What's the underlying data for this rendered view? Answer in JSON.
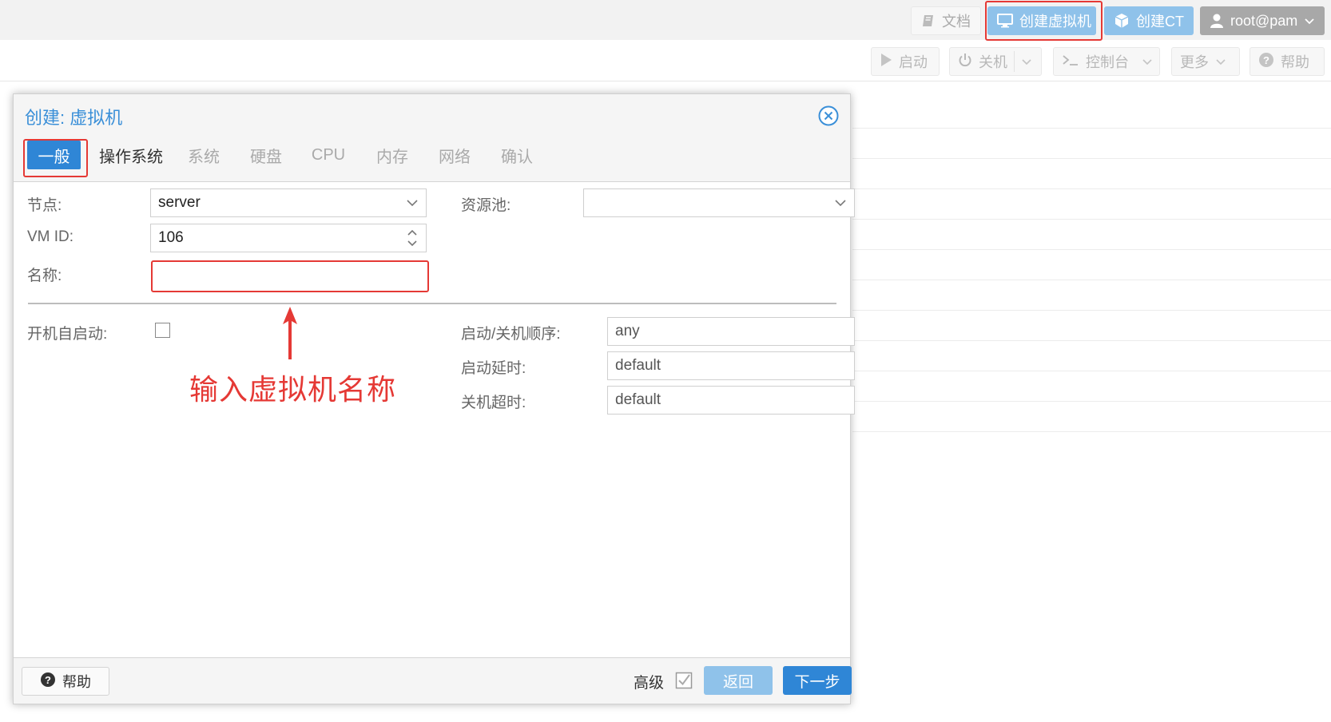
{
  "header": {
    "docs_label": "文档",
    "create_vm_label": "创建虚拟机",
    "create_ct_label": "创建CT",
    "user_label": "root@pam"
  },
  "toolbar": {
    "start_label": "启动",
    "shutdown_label": "关机",
    "console_label": "控制台",
    "more_label": "更多",
    "help_label": "帮助"
  },
  "dialog": {
    "title": "创建: 虚拟机",
    "tabs": [
      {
        "label": "一般"
      },
      {
        "label": "操作系统"
      },
      {
        "label": "系统"
      },
      {
        "label": "硬盘"
      },
      {
        "label": "CPU"
      },
      {
        "label": "内存"
      },
      {
        "label": "网络"
      },
      {
        "label": "确认"
      }
    ],
    "form": {
      "node_label": "节点:",
      "node_value": "server",
      "pool_label": "资源池:",
      "pool_value": "",
      "vmid_label": "VM ID:",
      "vmid_value": "106",
      "name_label": "名称:",
      "name_value": "",
      "onboot_label": "开机自启动:",
      "order_label": "启动/关机顺序:",
      "order_value": "any",
      "startup_delay_label": "启动延时:",
      "startup_delay_value": "default",
      "shutdown_timeout_label": "关机超时:",
      "shutdown_timeout_value": "default"
    },
    "annotation": "输入虚拟机名称",
    "footer": {
      "help_label": "帮助",
      "advanced_label": "高级",
      "back_label": "返回",
      "next_label": "下一步"
    }
  },
  "colors": {
    "accent": "#2f86d6",
    "accent_disabled": "#8fc2ea",
    "highlight": "#e53935"
  }
}
